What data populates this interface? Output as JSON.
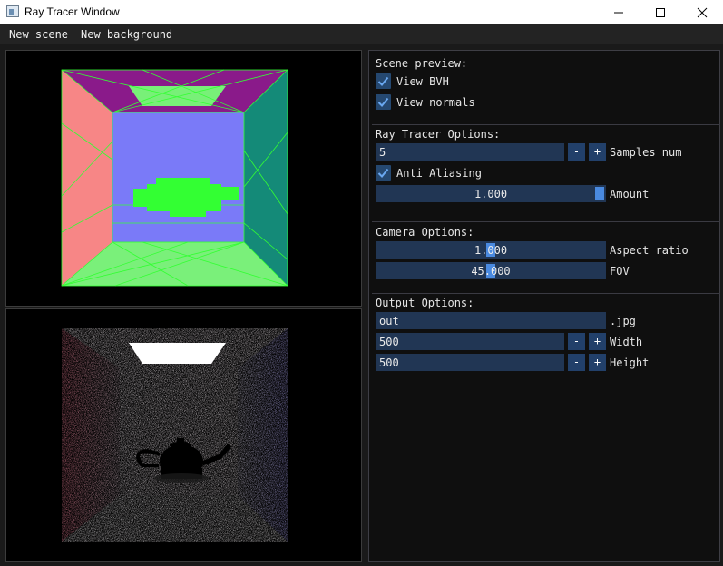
{
  "window": {
    "title": "Ray Tracer Window"
  },
  "menu": {
    "items": [
      "New scene",
      "New background"
    ]
  },
  "scene_preview": {
    "title": "Scene preview:",
    "view_bvh": {
      "label": "View BVH",
      "checked": true
    },
    "view_normals": {
      "label": "View normals",
      "checked": true
    }
  },
  "ray_tracer": {
    "title": "Ray Tracer Options:",
    "samples_value": "5",
    "samples_label": "Samples num",
    "anti_aliasing": {
      "label": "Anti Aliasing",
      "checked": true
    },
    "amount_value": "1.000",
    "amount_label": "Amount"
  },
  "camera": {
    "title": "Camera Options:",
    "aspect_value": "1.000",
    "aspect_label": "Aspect ratio",
    "fov_value": "45.000",
    "fov_label": "FOV"
  },
  "output": {
    "title": "Output Options:",
    "filename_value": "out",
    "extension": ".jpg",
    "width_value": "500",
    "width_label": "Width",
    "height_value": "500",
    "height_label": "Height"
  },
  "buttons": {
    "minus": "-",
    "plus": "+"
  },
  "colors": {
    "frame": "#213654",
    "grab": "#4a8ae0",
    "checkbox": "#254870",
    "check": "#6aa8f0"
  }
}
